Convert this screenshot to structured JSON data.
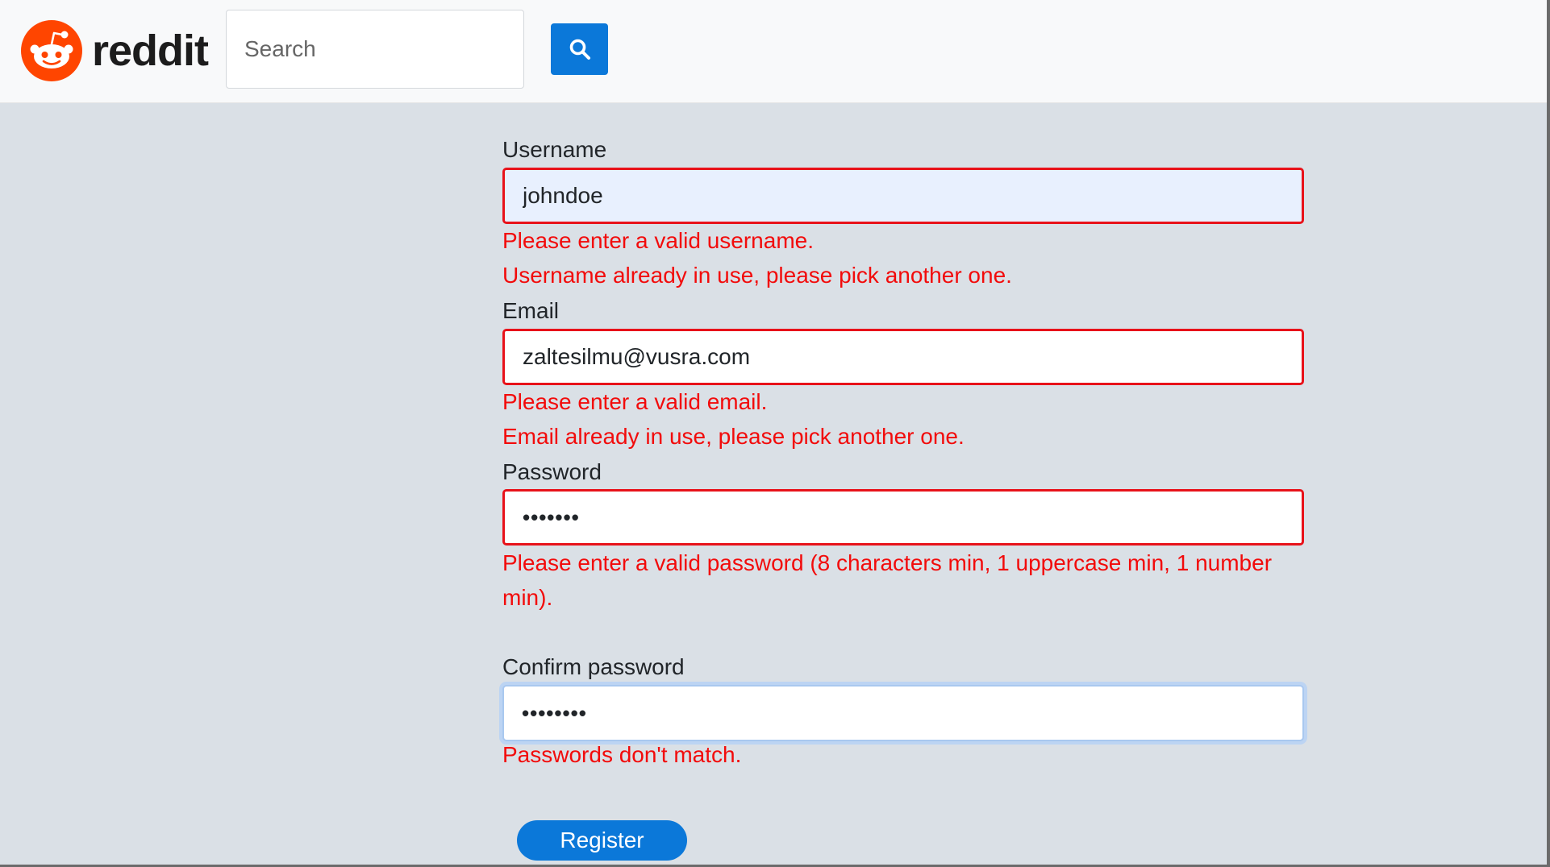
{
  "header": {
    "logo_text": "reddit",
    "search": {
      "placeholder": "Search",
      "value": ""
    }
  },
  "form": {
    "username": {
      "label": "Username",
      "value": "johndoe",
      "errors": [
        "Please enter a valid username.",
        "Username already in use, please pick another one."
      ]
    },
    "email": {
      "label": "Email",
      "value": "zaltesilmu@vusra.com",
      "errors": [
        "Please enter a valid email.",
        "Email already in use, please pick another one."
      ]
    },
    "password": {
      "label": "Password",
      "value": "•••••••",
      "errors": [
        "Please enter a valid password (8 characters min, 1 uppercase min, 1 number min)."
      ]
    },
    "confirm_password": {
      "label": "Confirm password",
      "value": "••••••••",
      "errors": [
        "Passwords don't match."
      ]
    },
    "register_label": "Register"
  },
  "colors": {
    "page_background": "#dae0e6",
    "header_background": "#f8f9fa",
    "primary_blue": "#0b78d9",
    "error_red": "#f20b0b",
    "logo_orange": "#ff4500"
  }
}
